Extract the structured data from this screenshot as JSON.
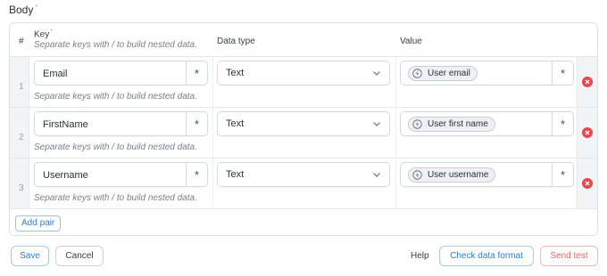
{
  "body_section": {
    "title": "Body",
    "required_mark": "*"
  },
  "table": {
    "headers": {
      "index": "#",
      "key": "Key",
      "key_required_mark": "*",
      "key_hint": "Separate keys with / to build nested data.",
      "data_type": "Data type",
      "value": "Value"
    },
    "rows": [
      {
        "index": "1",
        "key": "Email",
        "key_star": "*",
        "hint": "Separate keys with / to build nested data.",
        "data_type": "Text",
        "value_pill": "User email",
        "value_star": "*"
      },
      {
        "index": "2",
        "key": "FirstName",
        "key_star": "*",
        "hint": "Separate keys with / to build nested data.",
        "data_type": "Text",
        "value_pill": "User first name",
        "value_star": "*"
      },
      {
        "index": "3",
        "key": "Username",
        "key_star": "*",
        "hint": "Separate keys with / to build nested data.",
        "data_type": "Text",
        "value_pill": "User username",
        "value_star": "*"
      }
    ],
    "add_pair_label": "Add pair"
  },
  "footer": {
    "save_label": "Save",
    "cancel_label": "Cancel",
    "help_label": "Help",
    "check_label": "Check data format",
    "send_label": "Send test"
  },
  "colors": {
    "accent": "#2d7fd0",
    "danger": "#e5484d",
    "send_text": "#e4685d"
  },
  "icons": {
    "remove": "remove-circle-icon",
    "chevron": "chevron-down-icon",
    "pill": "variable-token-icon"
  }
}
